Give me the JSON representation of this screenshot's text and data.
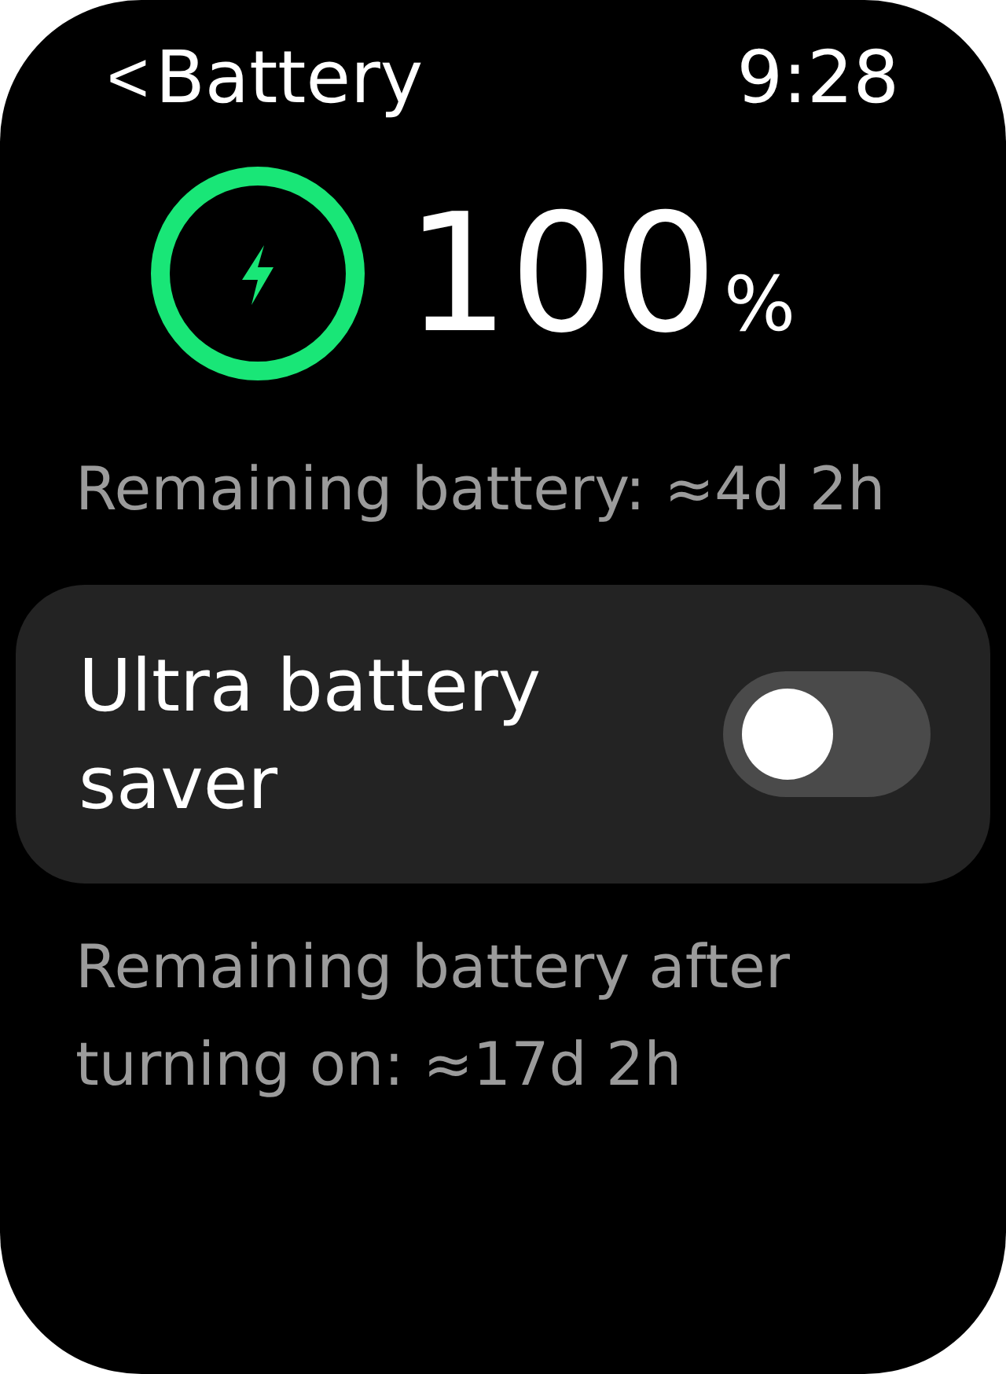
{
  "header": {
    "back": "<",
    "title": "Battery",
    "time": "9:28"
  },
  "battery": {
    "percent": "100",
    "unit": "%",
    "charging": true
  },
  "remaining": "Remaining battery: ≈4d 2h",
  "saver": {
    "label": "Ultra battery saver",
    "on": false
  },
  "saver_remaining": "Remaining battery after turning on: ≈17d 2h"
}
